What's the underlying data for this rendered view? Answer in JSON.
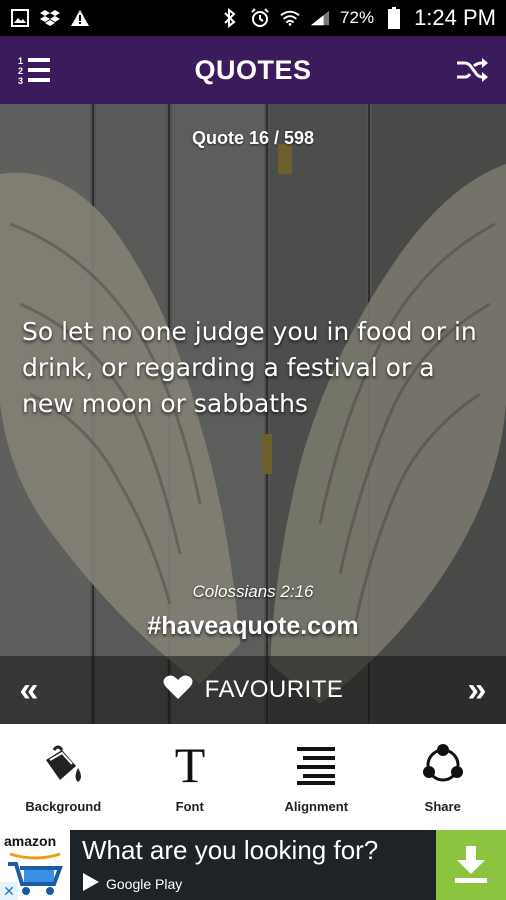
{
  "status_bar": {
    "battery_percent": "72%",
    "time": "1:24 PM"
  },
  "header": {
    "title": "QUOTES"
  },
  "quote": {
    "counter": "Quote 16 / 598",
    "text": "So let no one judge you in food or in drink, or regarding a festival or a new moon or sabbaths",
    "source": "Colossians 2:16",
    "hashtag": "#haveaquote.com",
    "favourite_label": "FAVOURITE",
    "prev_label": "«",
    "next_label": "»"
  },
  "tools": [
    {
      "label": "Background",
      "icon": "paint-bucket-icon"
    },
    {
      "label": "Font",
      "icon": "font-icon"
    },
    {
      "label": "Alignment",
      "icon": "alignment-icon"
    },
    {
      "label": "Share",
      "icon": "share-icon"
    }
  ],
  "ad": {
    "brand": "amazon",
    "headline": "What are you looking for?",
    "store": "Google Play",
    "close_label": "✕"
  },
  "colors": {
    "header_bg": "#3b1b5c",
    "download_bg": "#8dc43f",
    "ad_bg": "#1e2327"
  }
}
